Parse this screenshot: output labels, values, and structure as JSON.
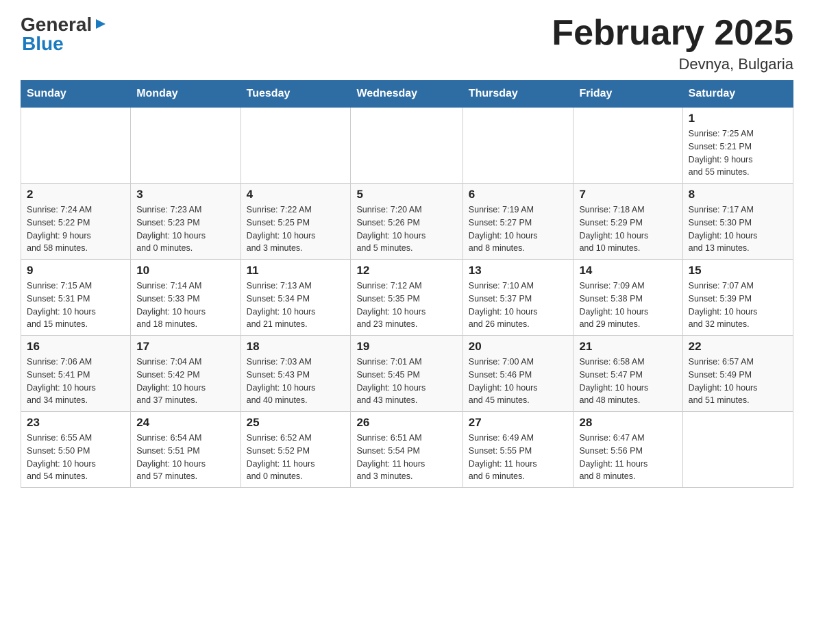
{
  "header": {
    "logo_general": "General",
    "logo_blue": "Blue",
    "title": "February 2025",
    "location": "Devnya, Bulgaria"
  },
  "days_of_week": [
    "Sunday",
    "Monday",
    "Tuesday",
    "Wednesday",
    "Thursday",
    "Friday",
    "Saturday"
  ],
  "weeks": [
    [
      {
        "day": "",
        "info": ""
      },
      {
        "day": "",
        "info": ""
      },
      {
        "day": "",
        "info": ""
      },
      {
        "day": "",
        "info": ""
      },
      {
        "day": "",
        "info": ""
      },
      {
        "day": "",
        "info": ""
      },
      {
        "day": "1",
        "info": "Sunrise: 7:25 AM\nSunset: 5:21 PM\nDaylight: 9 hours\nand 55 minutes."
      }
    ],
    [
      {
        "day": "2",
        "info": "Sunrise: 7:24 AM\nSunset: 5:22 PM\nDaylight: 9 hours\nand 58 minutes."
      },
      {
        "day": "3",
        "info": "Sunrise: 7:23 AM\nSunset: 5:23 PM\nDaylight: 10 hours\nand 0 minutes."
      },
      {
        "day": "4",
        "info": "Sunrise: 7:22 AM\nSunset: 5:25 PM\nDaylight: 10 hours\nand 3 minutes."
      },
      {
        "day": "5",
        "info": "Sunrise: 7:20 AM\nSunset: 5:26 PM\nDaylight: 10 hours\nand 5 minutes."
      },
      {
        "day": "6",
        "info": "Sunrise: 7:19 AM\nSunset: 5:27 PM\nDaylight: 10 hours\nand 8 minutes."
      },
      {
        "day": "7",
        "info": "Sunrise: 7:18 AM\nSunset: 5:29 PM\nDaylight: 10 hours\nand 10 minutes."
      },
      {
        "day": "8",
        "info": "Sunrise: 7:17 AM\nSunset: 5:30 PM\nDaylight: 10 hours\nand 13 minutes."
      }
    ],
    [
      {
        "day": "9",
        "info": "Sunrise: 7:15 AM\nSunset: 5:31 PM\nDaylight: 10 hours\nand 15 minutes."
      },
      {
        "day": "10",
        "info": "Sunrise: 7:14 AM\nSunset: 5:33 PM\nDaylight: 10 hours\nand 18 minutes."
      },
      {
        "day": "11",
        "info": "Sunrise: 7:13 AM\nSunset: 5:34 PM\nDaylight: 10 hours\nand 21 minutes."
      },
      {
        "day": "12",
        "info": "Sunrise: 7:12 AM\nSunset: 5:35 PM\nDaylight: 10 hours\nand 23 minutes."
      },
      {
        "day": "13",
        "info": "Sunrise: 7:10 AM\nSunset: 5:37 PM\nDaylight: 10 hours\nand 26 minutes."
      },
      {
        "day": "14",
        "info": "Sunrise: 7:09 AM\nSunset: 5:38 PM\nDaylight: 10 hours\nand 29 minutes."
      },
      {
        "day": "15",
        "info": "Sunrise: 7:07 AM\nSunset: 5:39 PM\nDaylight: 10 hours\nand 32 minutes."
      }
    ],
    [
      {
        "day": "16",
        "info": "Sunrise: 7:06 AM\nSunset: 5:41 PM\nDaylight: 10 hours\nand 34 minutes."
      },
      {
        "day": "17",
        "info": "Sunrise: 7:04 AM\nSunset: 5:42 PM\nDaylight: 10 hours\nand 37 minutes."
      },
      {
        "day": "18",
        "info": "Sunrise: 7:03 AM\nSunset: 5:43 PM\nDaylight: 10 hours\nand 40 minutes."
      },
      {
        "day": "19",
        "info": "Sunrise: 7:01 AM\nSunset: 5:45 PM\nDaylight: 10 hours\nand 43 minutes."
      },
      {
        "day": "20",
        "info": "Sunrise: 7:00 AM\nSunset: 5:46 PM\nDaylight: 10 hours\nand 45 minutes."
      },
      {
        "day": "21",
        "info": "Sunrise: 6:58 AM\nSunset: 5:47 PM\nDaylight: 10 hours\nand 48 minutes."
      },
      {
        "day": "22",
        "info": "Sunrise: 6:57 AM\nSunset: 5:49 PM\nDaylight: 10 hours\nand 51 minutes."
      }
    ],
    [
      {
        "day": "23",
        "info": "Sunrise: 6:55 AM\nSunset: 5:50 PM\nDaylight: 10 hours\nand 54 minutes."
      },
      {
        "day": "24",
        "info": "Sunrise: 6:54 AM\nSunset: 5:51 PM\nDaylight: 10 hours\nand 57 minutes."
      },
      {
        "day": "25",
        "info": "Sunrise: 6:52 AM\nSunset: 5:52 PM\nDaylight: 11 hours\nand 0 minutes."
      },
      {
        "day": "26",
        "info": "Sunrise: 6:51 AM\nSunset: 5:54 PM\nDaylight: 11 hours\nand 3 minutes."
      },
      {
        "day": "27",
        "info": "Sunrise: 6:49 AM\nSunset: 5:55 PM\nDaylight: 11 hours\nand 6 minutes."
      },
      {
        "day": "28",
        "info": "Sunrise: 6:47 AM\nSunset: 5:56 PM\nDaylight: 11 hours\nand 8 minutes."
      },
      {
        "day": "",
        "info": ""
      }
    ]
  ]
}
